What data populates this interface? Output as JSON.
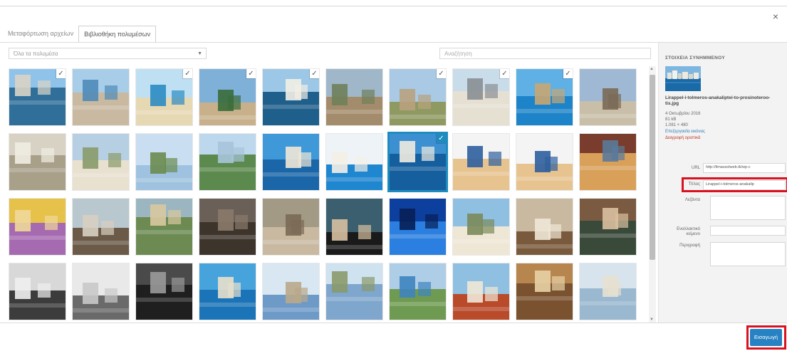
{
  "modal": {
    "close_icon": "close-icon"
  },
  "tabs": [
    {
      "label": "Μεταφόρτωση αρχείων",
      "active": false
    },
    {
      "label": "Βιβλιοθήκη πολυμέσων",
      "active": true
    }
  ],
  "toolbar": {
    "filter_value": "Όλα τα πολυμέσα",
    "search_placeholder": "Αναζήτηση"
  },
  "library": {
    "selected_index": 16,
    "checked_indices": [
      0,
      2,
      3,
      4,
      6,
      7,
      8,
      16
    ]
  },
  "details": {
    "title": "ΣΤΟΙΧΕΙΑ ΣΥΝΗΜΜΕΝΟΥ",
    "filename": "Lirappel-i-tolmeros-anakaliptei-to-prosinoteroo-tis.jpg",
    "date": "4 Οκτωβρίου 2016",
    "size": "81 kB",
    "dimensions": "1.081 × 480",
    "edit_link": "Επεξεργασία εικόνας",
    "delete_link": "Διαγραφή οριστικά",
    "url_label": "URL",
    "url_value": "http://limassolweb.tk/wp-c",
    "title_label": "Τίτλος",
    "title_value": "Lirappel-i-tolmeros-anakalip",
    "caption_label": "Λεζάντα",
    "alt_label": "Εναλλακτικό κείμενο",
    "desc_label": "Περιγραφή"
  },
  "footer": {
    "insert_label": "Εισαγωγή"
  },
  "colors": {
    "accent": "#1e8cbe",
    "button": "#2682c2",
    "highlight": "#d9121f"
  }
}
